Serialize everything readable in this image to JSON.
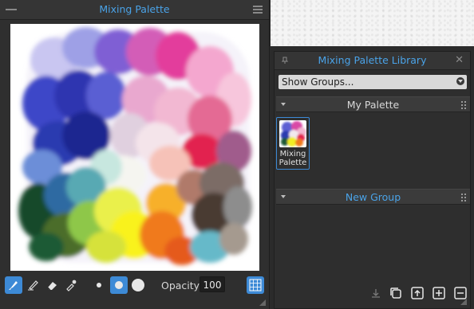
{
  "mixing_palette": {
    "title": "Mixing Palette",
    "opacity_label": "Opacity",
    "opacity_value": "100"
  },
  "library": {
    "title": "Mixing Palette Library",
    "groups_dropdown": "Show Groups...",
    "groups": [
      {
        "name": "My Palette",
        "palettes": [
          {
            "name": "Mixing Palette"
          }
        ]
      },
      {
        "name": "New Group",
        "palettes": []
      }
    ]
  },
  "colors": {
    "accent": "#3d8ad6",
    "title_text": "#4aa3e8"
  }
}
